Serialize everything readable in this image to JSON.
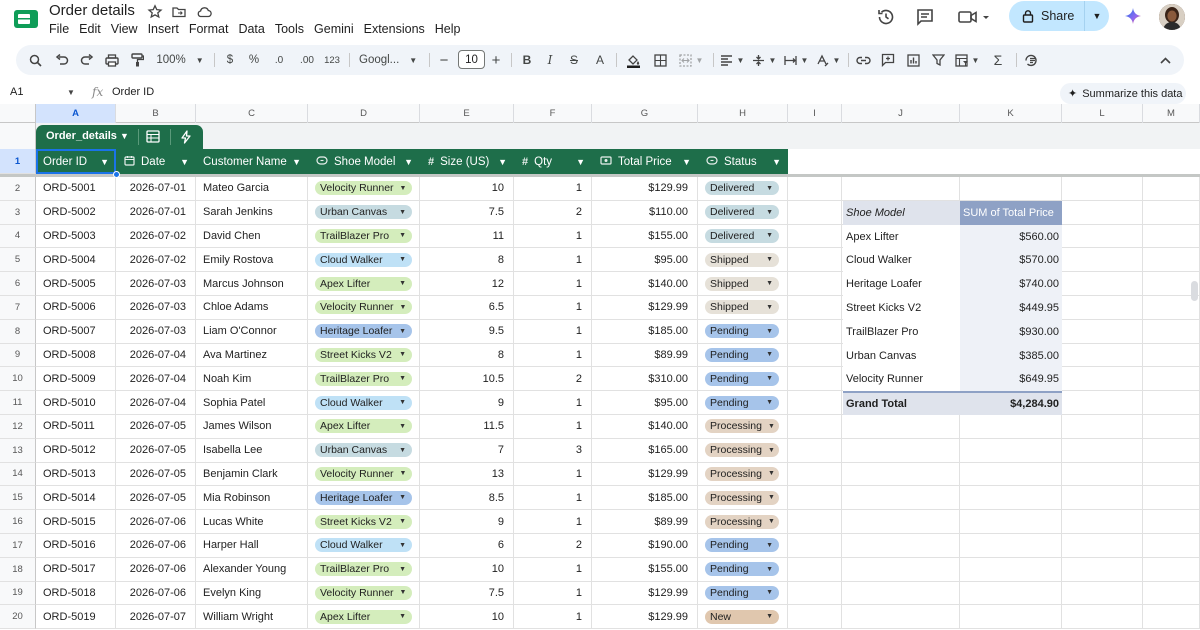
{
  "doc": {
    "title": "Order details",
    "menu": [
      "File",
      "Edit",
      "View",
      "Insert",
      "Format",
      "Data",
      "Tools",
      "Gemini",
      "Extensions",
      "Help"
    ],
    "share_label": "Share"
  },
  "toolbar": {
    "zoom": "100%",
    "currency": "$",
    "percent": "%",
    "dec_decrease": ".0",
    "dec_increase": ".00",
    "number_format": "123",
    "font": "Googl...",
    "font_size": "10"
  },
  "formula_bar": {
    "cell_ref": "A1",
    "fx": "fx",
    "content": "Order ID",
    "summarize_label": "Summarize this data"
  },
  "columns": [
    "A",
    "B",
    "C",
    "D",
    "E",
    "F",
    "G",
    "H",
    "I",
    "J",
    "K",
    "L",
    "M"
  ],
  "table": {
    "name": "Order_details",
    "headers": [
      "Order ID",
      "Date",
      "Customer Name",
      "Shoe Model",
      "Size (US)",
      "Qty",
      "Total Price",
      "Status"
    ],
    "rows": [
      [
        "ORD-5001",
        "2026-07-01",
        "Mateo Garcia",
        "Velocity Runner",
        "10",
        "1",
        "$129.99",
        "Delivered"
      ],
      [
        "ORD-5002",
        "2026-07-01",
        "Sarah Jenkins",
        "Urban Canvas",
        "7.5",
        "2",
        "$110.00",
        "Delivered"
      ],
      [
        "ORD-5003",
        "2026-07-02",
        "David Chen",
        "TrailBlazer Pro",
        "11",
        "1",
        "$155.00",
        "Delivered"
      ],
      [
        "ORD-5004",
        "2026-07-02",
        "Emily Rostova",
        "Cloud Walker",
        "8",
        "1",
        "$95.00",
        "Shipped"
      ],
      [
        "ORD-5005",
        "2026-07-03",
        "Marcus Johnson",
        "Apex Lifter",
        "12",
        "1",
        "$140.00",
        "Shipped"
      ],
      [
        "ORD-5006",
        "2026-07-03",
        "Chloe Adams",
        "Velocity Runner",
        "6.5",
        "1",
        "$129.99",
        "Shipped"
      ],
      [
        "ORD-5007",
        "2026-07-03",
        "Liam O'Connor",
        "Heritage Loafer",
        "9.5",
        "1",
        "$185.00",
        "Pending"
      ],
      [
        "ORD-5008",
        "2026-07-04",
        "Ava Martinez",
        "Street Kicks V2",
        "8",
        "1",
        "$89.99",
        "Pending"
      ],
      [
        "ORD-5009",
        "2026-07-04",
        "Noah Kim",
        "TrailBlazer Pro",
        "10.5",
        "2",
        "$310.00",
        "Pending"
      ],
      [
        "ORD-5010",
        "2026-07-04",
        "Sophia Patel",
        "Cloud Walker",
        "9",
        "1",
        "$95.00",
        "Pending"
      ],
      [
        "ORD-5011",
        "2026-07-05",
        "James Wilson",
        "Apex Lifter",
        "11.5",
        "1",
        "$140.00",
        "Processing"
      ],
      [
        "ORD-5012",
        "2026-07-05",
        "Isabella Lee",
        "Urban Canvas",
        "7",
        "3",
        "$165.00",
        "Processing"
      ],
      [
        "ORD-5013",
        "2026-07-05",
        "Benjamin Clark",
        "Velocity Runner",
        "13",
        "1",
        "$129.99",
        "Processing"
      ],
      [
        "ORD-5014",
        "2026-07-05",
        "Mia Robinson",
        "Heritage Loafer",
        "8.5",
        "1",
        "$185.00",
        "Processing"
      ],
      [
        "ORD-5015",
        "2026-07-06",
        "Lucas White",
        "Street Kicks V2",
        "9",
        "1",
        "$89.99",
        "Processing"
      ],
      [
        "ORD-5016",
        "2026-07-06",
        "Harper Hall",
        "Cloud Walker",
        "6",
        "2",
        "$190.00",
        "Pending"
      ],
      [
        "ORD-5017",
        "2026-07-06",
        "Alexander Young",
        "TrailBlazer Pro",
        "10",
        "1",
        "$155.00",
        "Pending"
      ],
      [
        "ORD-5018",
        "2026-07-06",
        "Evelyn King",
        "Velocity Runner",
        "7.5",
        "1",
        "$129.99",
        "Pending"
      ],
      [
        "ORD-5019",
        "2026-07-07",
        "William Wright",
        "Apex Lifter",
        "10",
        "1",
        "$129.99",
        "New"
      ]
    ]
  },
  "model_colors": {
    "Velocity Runner": "#d4edbc",
    "Urban Canvas": "#c6dbe1",
    "TrailBlazer Pro": "#d4edbc",
    "Cloud Walker": "#bfe1f6",
    "Apex Lifter": "#d4edbc",
    "Heritage Loafer": "#a6c4ea",
    "Street Kicks V2": "#d4edbc"
  },
  "status_colors": {
    "Delivered": "#c6dbe1",
    "Shipped": "#e6e1d8",
    "Pending": "#a6c4ea",
    "Processing": "#e3d3c3",
    "New": "#e0c7ae"
  },
  "pivot": {
    "header_label": "Shoe Model",
    "header_value": "SUM of Total Price",
    "rows": [
      [
        "Apex Lifter",
        "$560.00"
      ],
      [
        "Cloud Walker",
        "$570.00"
      ],
      [
        "Heritage Loafer",
        "$740.00"
      ],
      [
        "Street Kicks V2",
        "$449.95"
      ],
      [
        "TrailBlazer Pro",
        "$930.00"
      ],
      [
        "Urban Canvas",
        "$385.00"
      ],
      [
        "Velocity Runner",
        "$649.95"
      ]
    ],
    "total_label": "Grand Total",
    "total_value": "$4,284.90"
  }
}
